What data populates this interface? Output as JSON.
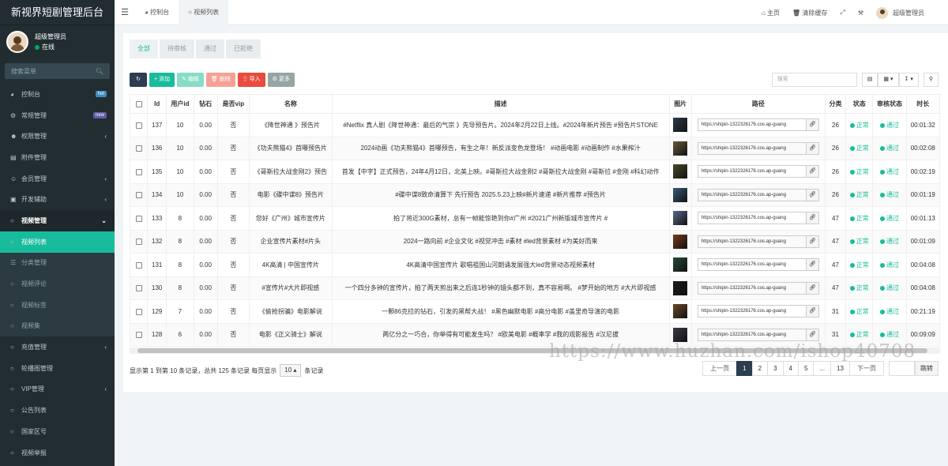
{
  "app": {
    "title": "新视界短剧管理后台"
  },
  "user": {
    "name": "超级管理员",
    "status": "在线"
  },
  "sidebar": {
    "search_placeholder": "搜索菜单",
    "items": [
      {
        "label": "控制台",
        "icon": "dashboard-icon",
        "badge": "hot",
        "badge_color": "#3c8dbc"
      },
      {
        "label": "常规管理",
        "icon": "cogs-icon",
        "badge": "new",
        "badge_color": "#605ca8"
      },
      {
        "label": "权限管理",
        "icon": "group-icon",
        "arrow": "‹"
      },
      {
        "label": "附件管理",
        "icon": "file-icon"
      },
      {
        "label": "会员管理",
        "icon": "user-icon",
        "arrow": "‹"
      },
      {
        "label": "开发辅助",
        "icon": "cube-icon",
        "arrow": "‹"
      },
      {
        "label": "视频管理",
        "icon": "circle-icon",
        "arrow": "⌄"
      },
      {
        "label": "视频列表",
        "icon": "circle-icon"
      },
      {
        "label": "分类管理",
        "icon": "list-icon"
      },
      {
        "label": "视频评论",
        "icon": "circle-icon"
      },
      {
        "label": "视频标签",
        "icon": "circle-icon"
      },
      {
        "label": "视频集",
        "icon": "circle-icon"
      },
      {
        "label": "充值管理",
        "icon": "circle-icon",
        "arrow": "‹"
      },
      {
        "label": "轮播图管理",
        "icon": "circle-icon"
      },
      {
        "label": "VIP管理",
        "icon": "circle-icon",
        "arrow": "‹"
      },
      {
        "label": "公告列表",
        "icon": "circle-icon"
      },
      {
        "label": "国家区号",
        "icon": "circle-icon"
      },
      {
        "label": "视频举报",
        "icon": "circle-icon"
      }
    ]
  },
  "topbar": {
    "tabs": [
      "控制台",
      "视频列表"
    ],
    "home": "主页",
    "clear_cache": "清除缓存",
    "user": "超级管理员"
  },
  "filter_tabs": [
    "全部",
    "待审核",
    "通过",
    "已拒绝"
  ],
  "toolbar": {
    "add": "添加",
    "edit": "编辑",
    "delete": "删除",
    "import": "导入",
    "more": "更多",
    "search_placeholder": "搜索"
  },
  "table": {
    "headers": [
      "Id",
      "用户id",
      "钻石",
      "是否vip",
      "名称",
      "描述",
      "图片",
      "路径",
      "分类",
      "状态",
      "审核状态",
      "时长"
    ],
    "rows": [
      {
        "id": "137",
        "uid": "10",
        "diamond": "0.00",
        "vip": "否",
        "name": "《降世神通 》预告片",
        "desc": "#Netflix 真人剧《降世神通：最后的气宗 》先导预告片。2024年2月22日上线。#2024年新片预告 #预告片STONE",
        "path": "https://shipin-1322326176.cos.ap-guang",
        "cat": "26",
        "status": "正常",
        "audit": "通过",
        "dur": "00:01:32",
        "img": "#2a3a4a"
      },
      {
        "id": "136",
        "uid": "10",
        "diamond": "0.00",
        "vip": "否",
        "name": "《功夫熊猫4》首曝预告片",
        "desc": "2024动画《功夫熊猫4》首曝预告，有生之年！新反派变色龙登场！ #动画电影 #动画制作 #水果榨汁",
        "path": "https://shipin-1322326176.cos.ap-guang",
        "cat": "26",
        "status": "正常",
        "audit": "通过",
        "dur": "00:02:08",
        "img": "#6a5a3a"
      },
      {
        "id": "135",
        "uid": "10",
        "diamond": "0.00",
        "vip": "否",
        "name": "《哥斯拉大战金刚2》预告",
        "desc": "首发【中字】正式预告，24年4月12日，北美上映。#哥斯拉大战金刚2 #哥斯拉大战金刚 #哥斯拉 #金刚 #科幻动作",
        "path": "https://shipin-1322326176.cos.ap-guang",
        "cat": "26",
        "status": "正常",
        "audit": "通过",
        "dur": "00:02:19",
        "img": "#4a4a2a"
      },
      {
        "id": "134",
        "uid": "10",
        "diamond": "0.00",
        "vip": "否",
        "name": "电影《碟中谍8》预告片",
        "desc": "#碟中谍8致命清算下 先行预告 2025.5.23上映#新片速递 #新片推荐 #预告片",
        "path": "https://shipin-1322326176.cos.ap-guang",
        "cat": "26",
        "status": "正常",
        "audit": "通过",
        "dur": "00:01:19",
        "img": "#3a5a7a"
      },
      {
        "id": "133",
        "uid": "8",
        "diamond": "0.00",
        "vip": "否",
        "name": "您好《广州》城市宣传片",
        "desc": "拍了将近300G素材，总有一帧能惊艳到你#广州 #2021广州新版城市宣传片 #",
        "path": "https://shipin-1322326176.cos.ap-guang",
        "cat": "47",
        "status": "正常",
        "audit": "通过",
        "dur": "00:01:13",
        "img": "#5a6a8a"
      },
      {
        "id": "132",
        "uid": "8",
        "diamond": "0.00",
        "vip": "否",
        "name": "企业宣传片素材#片头",
        "desc": "2024一路向前 #企业文化 #视觉冲击 #素材 #led背景素材 #为美好而来",
        "path": "https://shipin-1322326176.cos.ap-guang",
        "cat": "47",
        "status": "正常",
        "audit": "通过",
        "dur": "00:01:09",
        "img": "#7a3a1a"
      },
      {
        "id": "131",
        "uid": "8",
        "diamond": "0.00",
        "vip": "否",
        "name": "4K高清 | 中国宣传片",
        "desc": "4K高清中国宣传片 歌唱祖国山河朗诵发展强大led背景动态视频素材",
        "path": "https://shipin-1322326176.cos.ap-guang",
        "cat": "47",
        "status": "正常",
        "audit": "通过",
        "dur": "00:04:08",
        "img": "#2a4a3a"
      },
      {
        "id": "130",
        "uid": "8",
        "diamond": "0.00",
        "vip": "否",
        "name": "#宣传片#大片即视感",
        "desc": "一个四分多钟的宣传片，拍了两天剪出来之后连1秒钟的镜头都不到，真不容易啊。 #梦开始的地方 #大片即视感",
        "path": "https://shipin-1322326176.cos.ap-guang",
        "cat": "47",
        "status": "正常",
        "audit": "通过",
        "dur": "00:04:08",
        "img": "#1a1a1a"
      },
      {
        "id": "129",
        "uid": "7",
        "diamond": "0.00",
        "vip": "否",
        "name": "《偷抢拐骗》电影解说",
        "desc": "一颗86克拉的钻石，引发的黑帮大战！ #黑色幽默电影 #高分电影 #盖里奇导演的电影",
        "path": "https://shipin-1322326176.cos.ap-guang",
        "cat": "31",
        "status": "正常",
        "audit": "通过",
        "dur": "00:21:19",
        "img": "#6a4a2a"
      },
      {
        "id": "128",
        "uid": "6",
        "diamond": "0.00",
        "vip": "否",
        "name": "电影《正义骑士》解说",
        "desc": "两亿分之一巧合，你举得有可能发生吗？ #欧美电影 #概率学 #我的观影报告 #汉尼拔",
        "path": "https://shipin-1322326176.cos.ap-guang",
        "cat": "31",
        "status": "正常",
        "audit": "通过",
        "dur": "00:09:09",
        "img": "#3a3a4a"
      }
    ]
  },
  "pagination": {
    "info_prefix": "显示第 1 到第 10 条记录，总共 125 条记录 每页显示",
    "page_size": "10",
    "info_suffix": "条记录",
    "prev": "上一页",
    "pages": [
      "1",
      "2",
      "3",
      "4",
      "5",
      "...",
      "13"
    ],
    "next": "下一页",
    "go": "跳转"
  },
  "watermark": "https://www.huzhan.com/ishop40708"
}
